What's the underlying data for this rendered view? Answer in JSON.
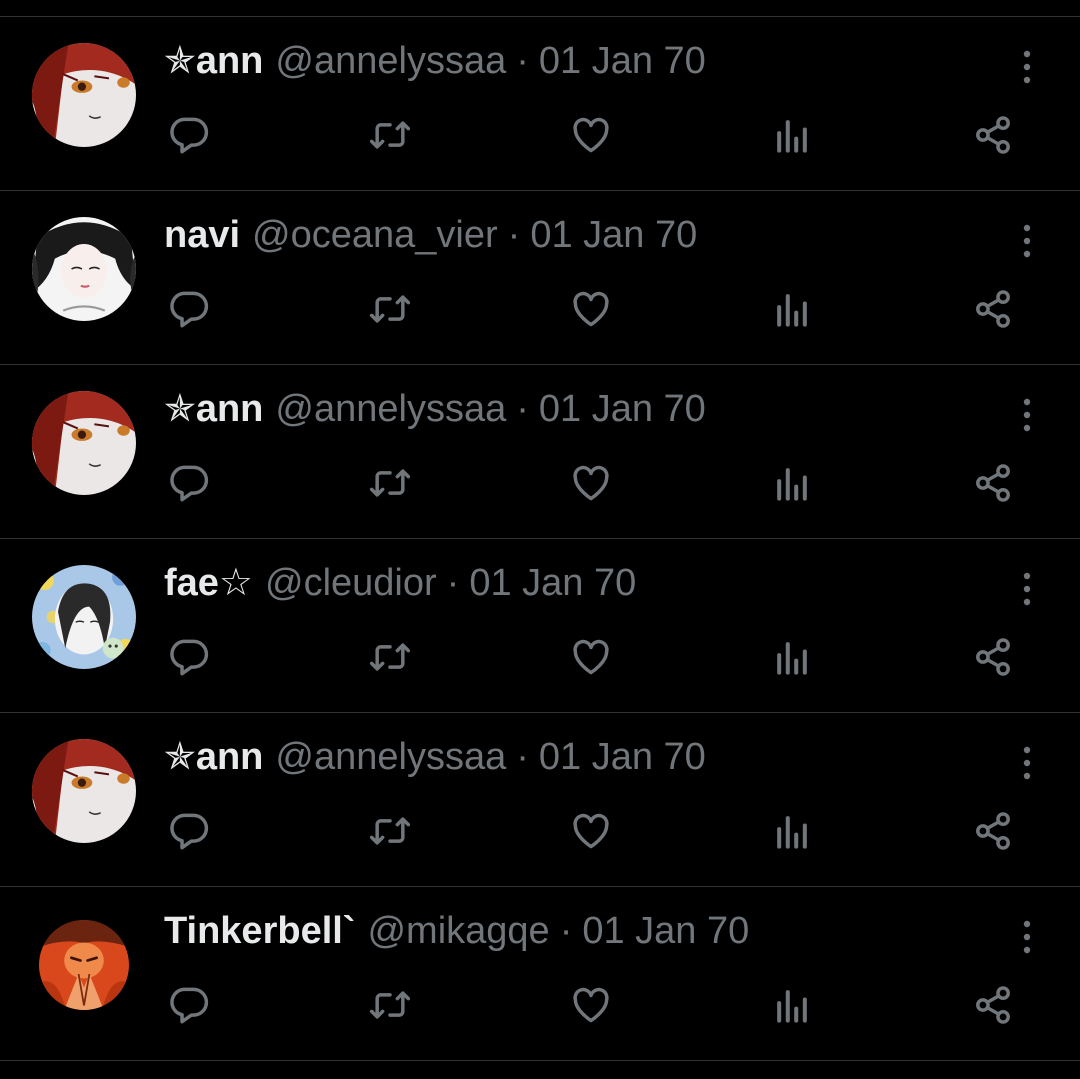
{
  "theme": {
    "background": "#000000",
    "divider": "#2f3336",
    "name_color": "#e7e9ea",
    "muted_color": "#71767b"
  },
  "icons": {
    "more": "more-vertical-icon",
    "reply": "reply-icon",
    "retweet": "retweet-icon",
    "like": "heart-icon",
    "views": "views-bar-chart-icon",
    "share": "share-icon"
  },
  "posts": [
    {
      "name": "✯ann",
      "handle": "@annelyssaa",
      "separator": "·",
      "date": "01 Jan 70",
      "avatar": "red-haired anime girl avatar"
    },
    {
      "name": "navi",
      "handle": "@oceana_vier",
      "separator": "·",
      "date": "01 Jan 70",
      "avatar": "black-haired manhwa girl avatar"
    },
    {
      "name": "✯ann",
      "handle": "@annelyssaa",
      "separator": "·",
      "date": "01 Jan 70",
      "avatar": "red-haired anime girl avatar"
    },
    {
      "name": "fae☆",
      "handle": "@cleudior",
      "separator": "·",
      "date": "01 Jan 70",
      "avatar": "blue floral sketch avatar"
    },
    {
      "name": "✯ann",
      "handle": "@annelyssaa",
      "separator": "·",
      "date": "01 Jan 70",
      "avatar": "red-haired anime girl avatar"
    },
    {
      "name": "Tinkerbell`",
      "handle": "@mikagqe",
      "separator": "·",
      "date": "01 Jan 70",
      "avatar": "orange cursed-sorcerer avatar"
    }
  ]
}
